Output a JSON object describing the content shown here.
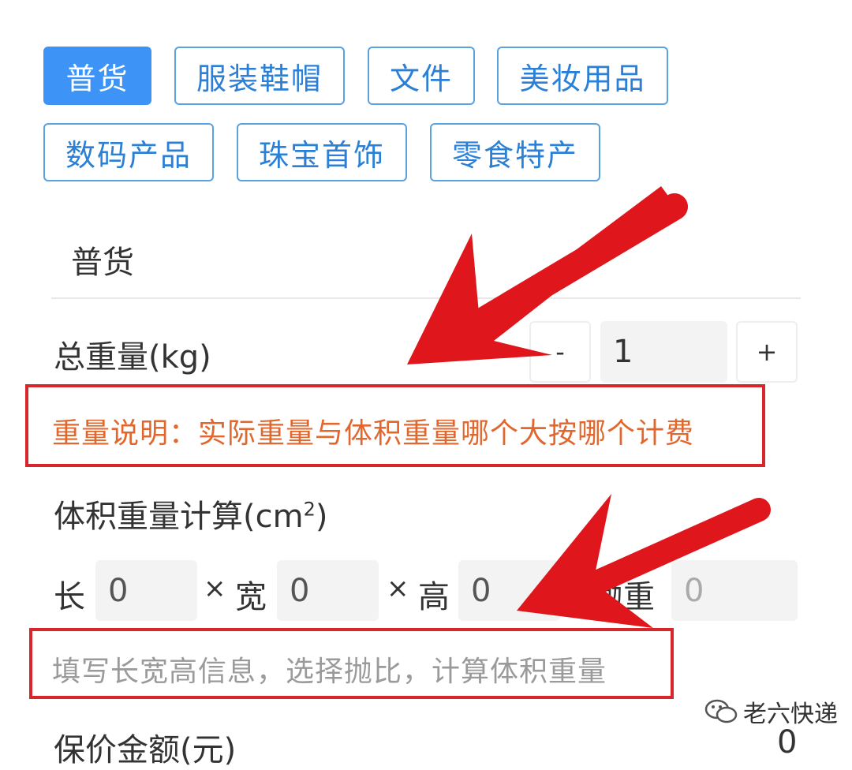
{
  "categories": [
    {
      "label": "普货",
      "active": true
    },
    {
      "label": "服装鞋帽",
      "active": false
    },
    {
      "label": "文件",
      "active": false
    },
    {
      "label": "美妆用品",
      "active": false
    },
    {
      "label": "数码产品",
      "active": false
    },
    {
      "label": "珠宝首饰",
      "active": false
    },
    {
      "label": "零食特产",
      "active": false
    }
  ],
  "selected_category": "普货",
  "weight": {
    "label": "总重量(kg)",
    "minus": "-",
    "value": "1",
    "plus": "+",
    "note": "重量说明：实际重量与体积重量哪个大按哪个计费"
  },
  "volume": {
    "label_main": "体积重量计算(cm",
    "label_sup": "2",
    "label_end": ")",
    "length_label": "长",
    "length_value": "0",
    "times1": "×",
    "width_label": "宽",
    "width_value": "0",
    "times2": "×",
    "height_label": "高",
    "height_value": "0",
    "result_label": "抛重",
    "result_value": "0",
    "hint": "填写长宽高信息，选择抛比，计算体积重量"
  },
  "insured": {
    "label": "保价金额(元)",
    "value": "0"
  },
  "watermark": "老六快递",
  "colors": {
    "accent": "#3d94f6",
    "annotation_red": "#e0161d",
    "note_orange": "#e0672e"
  },
  "icons": [
    "wechat-icon",
    "arrow-annotation"
  ]
}
